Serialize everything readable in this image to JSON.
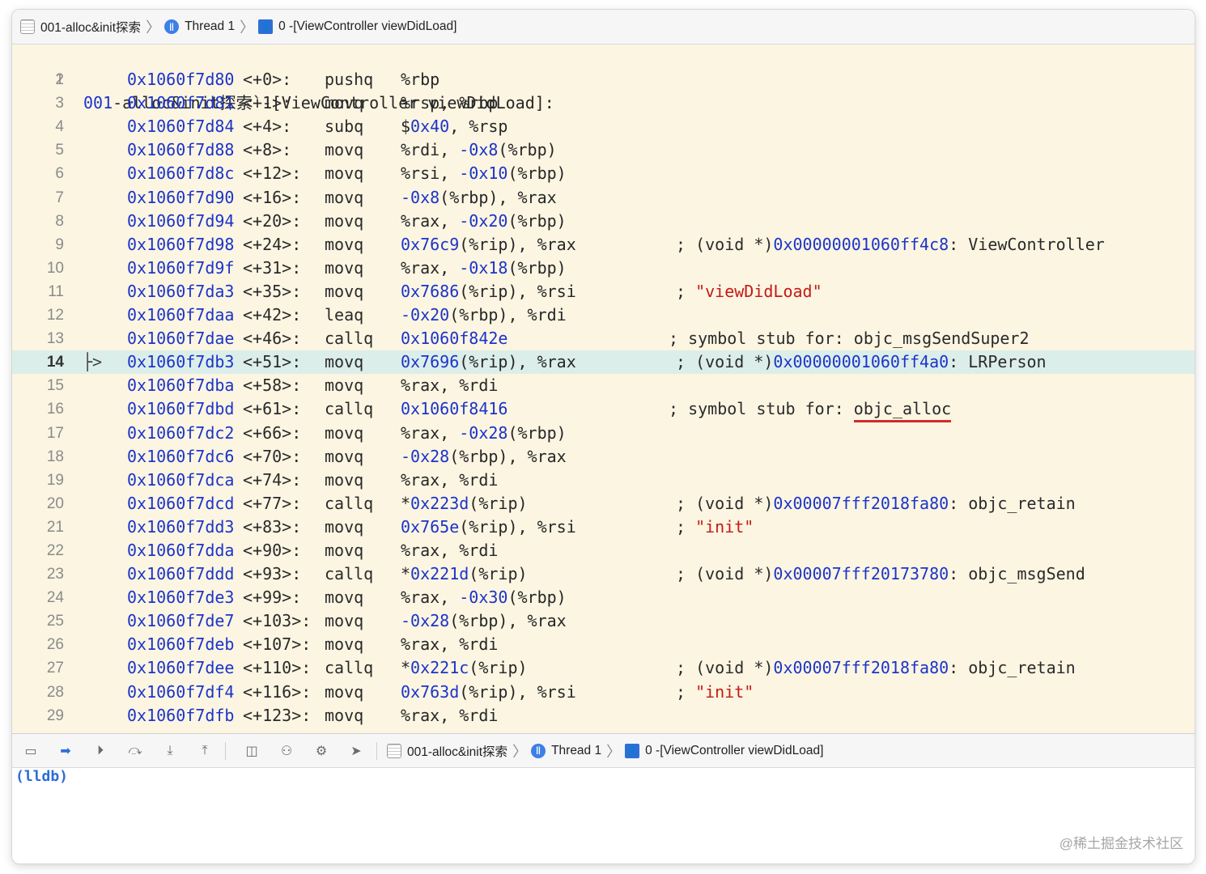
{
  "jumpbar": {
    "project": "001-alloc&init探索",
    "thread": "Thread 1",
    "frame": "0 -[ViewController viewDidLoad]"
  },
  "disassembly": {
    "header_line_no": "1",
    "header_prefix": "001",
    "header_rest": "-alloc&init探索`-[ViewController viewDidLoad]:",
    "current_line": 14,
    "pc_marker": "├>",
    "lines": [
      {
        "no": "2",
        "addr": "0x1060f7d80",
        "off": "<+0>:",
        "mn": "pushq",
        "ops": [
          {
            "t": "%rbp"
          }
        ],
        "comment": []
      },
      {
        "no": "3",
        "addr": "0x1060f7d81",
        "off": "<+1>:",
        "mn": "movq",
        "ops": [
          {
            "t": "%rsp, %rbp"
          }
        ],
        "comment": []
      },
      {
        "no": "4",
        "addr": "0x1060f7d84",
        "off": "<+4>:",
        "mn": "subq",
        "ops": [
          {
            "t": "$"
          },
          {
            "t": "0x40",
            "c": "hexn"
          },
          {
            "t": ", %rsp"
          }
        ],
        "comment": []
      },
      {
        "no": "5",
        "addr": "0x1060f7d88",
        "off": "<+8>:",
        "mn": "movq",
        "ops": [
          {
            "t": "%rdi, "
          },
          {
            "t": "-0x8",
            "c": "hexn"
          },
          {
            "t": "(%rbp)"
          }
        ],
        "comment": []
      },
      {
        "no": "6",
        "addr": "0x1060f7d8c",
        "off": "<+12>:",
        "mn": "movq",
        "ops": [
          {
            "t": "%rsi, "
          },
          {
            "t": "-0x10",
            "c": "hexn"
          },
          {
            "t": "(%rbp)"
          }
        ],
        "comment": []
      },
      {
        "no": "7",
        "addr": "0x1060f7d90",
        "off": "<+16>:",
        "mn": "movq",
        "ops": [
          {
            "t": "-0x8",
            "c": "hexn"
          },
          {
            "t": "(%rbp), %rax"
          }
        ],
        "comment": []
      },
      {
        "no": "8",
        "addr": "0x1060f7d94",
        "off": "<+20>:",
        "mn": "movq",
        "ops": [
          {
            "t": "%rax, "
          },
          {
            "t": "-0x20",
            "c": "hexn"
          },
          {
            "t": "(%rbp)"
          }
        ],
        "comment": []
      },
      {
        "no": "9",
        "addr": "0x1060f7d98",
        "off": "<+24>:",
        "mn": "movq",
        "ops": [
          {
            "t": "0x76c9",
            "c": "hexn"
          },
          {
            "t": "(%rip), %rax"
          }
        ],
        "comment": [
          {
            "t": "; (void *)"
          },
          {
            "t": "0x00000001060ff4c8",
            "c": "hexn"
          },
          {
            "t": ": ViewController"
          }
        ]
      },
      {
        "no": "10",
        "addr": "0x1060f7d9f",
        "off": "<+31>:",
        "mn": "movq",
        "ops": [
          {
            "t": "%rax, "
          },
          {
            "t": "-0x18",
            "c": "hexn"
          },
          {
            "t": "(%rbp)"
          }
        ],
        "comment": []
      },
      {
        "no": "11",
        "addr": "0x1060f7da3",
        "off": "<+35>:",
        "mn": "movq",
        "ops": [
          {
            "t": "0x7686",
            "c": "hexn"
          },
          {
            "t": "(%rip), %rsi"
          }
        ],
        "comment": [
          {
            "t": "; "
          },
          {
            "t": "\"viewDidLoad\"",
            "c": "str"
          }
        ]
      },
      {
        "no": "12",
        "addr": "0x1060f7daa",
        "off": "<+42>:",
        "mn": "leaq",
        "ops": [
          {
            "t": "-0x20",
            "c": "hexn"
          },
          {
            "t": "(%rbp), %rdi"
          }
        ],
        "comment": []
      },
      {
        "no": "13",
        "addr": "0x1060f7dae",
        "off": "<+46>:",
        "mn": "callq",
        "ops": [
          {
            "t": "0x1060f842e",
            "c": "hexn"
          }
        ],
        "comment": [
          {
            "t": "; symbol stub for: objc_msgSendSuper2"
          }
        ],
        "cshift": true
      },
      {
        "no": "14",
        "addr": "0x1060f7db3",
        "off": "<+51>:",
        "mn": "movq",
        "ops": [
          {
            "t": "0x7696",
            "c": "hexn"
          },
          {
            "t": "(%rip), %rax"
          }
        ],
        "comment": [
          {
            "t": "; (void *)"
          },
          {
            "t": "0x00000001060ff4a0",
            "c": "hexn"
          },
          {
            "t": ": LRPerson"
          }
        ]
      },
      {
        "no": "15",
        "addr": "0x1060f7dba",
        "off": "<+58>:",
        "mn": "movq",
        "ops": [
          {
            "t": "%rax, %rdi"
          }
        ],
        "comment": []
      },
      {
        "no": "16",
        "addr": "0x1060f7dbd",
        "off": "<+61>:",
        "mn": "callq",
        "ops": [
          {
            "t": "0x1060f8416",
            "c": "hexn"
          }
        ],
        "comment": [
          {
            "t": "; symbol stub for: "
          },
          {
            "t": "objc_alloc",
            "c": "uline"
          }
        ],
        "cshift": true
      },
      {
        "no": "17",
        "addr": "0x1060f7dc2",
        "off": "<+66>:",
        "mn": "movq",
        "ops": [
          {
            "t": "%rax, "
          },
          {
            "t": "-0x28",
            "c": "hexn"
          },
          {
            "t": "(%rbp)"
          }
        ],
        "comment": []
      },
      {
        "no": "18",
        "addr": "0x1060f7dc6",
        "off": "<+70>:",
        "mn": "movq",
        "ops": [
          {
            "t": "-0x28",
            "c": "hexn"
          },
          {
            "t": "(%rbp), %rax"
          }
        ],
        "comment": []
      },
      {
        "no": "19",
        "addr": "0x1060f7dca",
        "off": "<+74>:",
        "mn": "movq",
        "ops": [
          {
            "t": "%rax, %rdi"
          }
        ],
        "comment": []
      },
      {
        "no": "20",
        "addr": "0x1060f7dcd",
        "off": "<+77>:",
        "mn": "callq",
        "ops": [
          {
            "t": "*"
          },
          {
            "t": "0x223d",
            "c": "hexn"
          },
          {
            "t": "(%rip)"
          }
        ],
        "comment": [
          {
            "t": "; (void *)"
          },
          {
            "t": "0x00007fff2018fa80",
            "c": "hexn"
          },
          {
            "t": ": objc_retain"
          }
        ]
      },
      {
        "no": "21",
        "addr": "0x1060f7dd3",
        "off": "<+83>:",
        "mn": "movq",
        "ops": [
          {
            "t": "0x765e",
            "c": "hexn"
          },
          {
            "t": "(%rip), %rsi"
          }
        ],
        "comment": [
          {
            "t": "; "
          },
          {
            "t": "\"init\"",
            "c": "str"
          }
        ]
      },
      {
        "no": "22",
        "addr": "0x1060f7dda",
        "off": "<+90>:",
        "mn": "movq",
        "ops": [
          {
            "t": "%rax, %rdi"
          }
        ],
        "comment": []
      },
      {
        "no": "23",
        "addr": "0x1060f7ddd",
        "off": "<+93>:",
        "mn": "callq",
        "ops": [
          {
            "t": "*"
          },
          {
            "t": "0x221d",
            "c": "hexn"
          },
          {
            "t": "(%rip)"
          }
        ],
        "comment": [
          {
            "t": "; (void *)"
          },
          {
            "t": "0x00007fff20173780",
            "c": "hexn"
          },
          {
            "t": ": objc_msgSend"
          }
        ]
      },
      {
        "no": "24",
        "addr": "0x1060f7de3",
        "off": "<+99>:",
        "mn": "movq",
        "ops": [
          {
            "t": "%rax, "
          },
          {
            "t": "-0x30",
            "c": "hexn"
          },
          {
            "t": "(%rbp)"
          }
        ],
        "comment": []
      },
      {
        "no": "25",
        "addr": "0x1060f7de7",
        "off": "<+103>:",
        "mn": "movq",
        "ops": [
          {
            "t": "-0x28",
            "c": "hexn"
          },
          {
            "t": "(%rbp), %rax"
          }
        ],
        "comment": []
      },
      {
        "no": "26",
        "addr": "0x1060f7deb",
        "off": "<+107>:",
        "mn": "movq",
        "ops": [
          {
            "t": "%rax, %rdi"
          }
        ],
        "comment": []
      },
      {
        "no": "27",
        "addr": "0x1060f7dee",
        "off": "<+110>:",
        "mn": "callq",
        "ops": [
          {
            "t": "*"
          },
          {
            "t": "0x221c",
            "c": "hexn"
          },
          {
            "t": "(%rip)"
          }
        ],
        "comment": [
          {
            "t": "; (void *)"
          },
          {
            "t": "0x00007fff2018fa80",
            "c": "hexn"
          },
          {
            "t": ": objc_retain"
          }
        ]
      },
      {
        "no": "28",
        "addr": "0x1060f7df4",
        "off": "<+116>:",
        "mn": "movq",
        "ops": [
          {
            "t": "0x763d",
            "c": "hexn"
          },
          {
            "t": "(%rip), %rsi"
          }
        ],
        "comment": [
          {
            "t": "; "
          },
          {
            "t": "\"init\"",
            "c": "str"
          }
        ]
      },
      {
        "no": "29",
        "addr": "0x1060f7dfb",
        "off": "<+123>:",
        "mn": "movq",
        "ops": [
          {
            "t": "%rax, %rdi"
          }
        ],
        "comment": []
      }
    ]
  },
  "debug_bar": {
    "project": "001-alloc&init探索",
    "thread": "Thread 1",
    "frame": "0 -[ViewController viewDidLoad]",
    "buttons": [
      {
        "name": "hide-debug-area-button",
        "icon": "▭"
      },
      {
        "name": "breakpoints-toggle-button",
        "icon": "➡"
      },
      {
        "name": "continue-button",
        "icon": "⏵"
      },
      {
        "name": "step-over-button",
        "icon": "⤼"
      },
      {
        "name": "step-into-button",
        "icon": "⤓"
      },
      {
        "name": "step-out-button",
        "icon": "⤒"
      },
      {
        "name": "view-hierarchy-button",
        "icon": "◫"
      },
      {
        "name": "memory-graph-button",
        "icon": "⚇"
      },
      {
        "name": "environment-overrides-button",
        "icon": "⚙"
      },
      {
        "name": "simulate-location-button",
        "icon": "➤"
      }
    ]
  },
  "console": {
    "prompt": "(lldb)"
  },
  "watermark": "@稀土掘金技术社区"
}
